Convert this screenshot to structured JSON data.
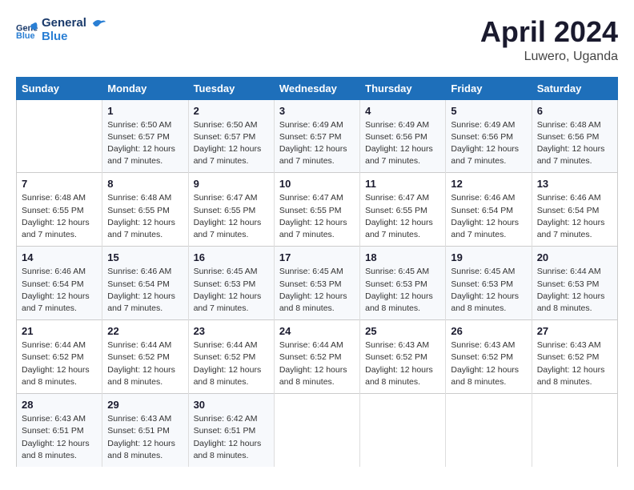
{
  "header": {
    "logo_general": "General",
    "logo_blue": "Blue",
    "month_year": "April 2024",
    "location": "Luwero, Uganda"
  },
  "columns": [
    "Sunday",
    "Monday",
    "Tuesday",
    "Wednesday",
    "Thursday",
    "Friday",
    "Saturday"
  ],
  "weeks": [
    [
      {
        "day": "",
        "info": ""
      },
      {
        "day": "1",
        "info": "Sunrise: 6:50 AM\nSunset: 6:57 PM\nDaylight: 12 hours\nand 7 minutes."
      },
      {
        "day": "2",
        "info": "Sunrise: 6:50 AM\nSunset: 6:57 PM\nDaylight: 12 hours\nand 7 minutes."
      },
      {
        "day": "3",
        "info": "Sunrise: 6:49 AM\nSunset: 6:57 PM\nDaylight: 12 hours\nand 7 minutes."
      },
      {
        "day": "4",
        "info": "Sunrise: 6:49 AM\nSunset: 6:56 PM\nDaylight: 12 hours\nand 7 minutes."
      },
      {
        "day": "5",
        "info": "Sunrise: 6:49 AM\nSunset: 6:56 PM\nDaylight: 12 hours\nand 7 minutes."
      },
      {
        "day": "6",
        "info": "Sunrise: 6:48 AM\nSunset: 6:56 PM\nDaylight: 12 hours\nand 7 minutes."
      }
    ],
    [
      {
        "day": "7",
        "info": "Sunrise: 6:48 AM\nSunset: 6:55 PM\nDaylight: 12 hours\nand 7 minutes."
      },
      {
        "day": "8",
        "info": "Sunrise: 6:48 AM\nSunset: 6:55 PM\nDaylight: 12 hours\nand 7 minutes."
      },
      {
        "day": "9",
        "info": "Sunrise: 6:47 AM\nSunset: 6:55 PM\nDaylight: 12 hours\nand 7 minutes."
      },
      {
        "day": "10",
        "info": "Sunrise: 6:47 AM\nSunset: 6:55 PM\nDaylight: 12 hours\nand 7 minutes."
      },
      {
        "day": "11",
        "info": "Sunrise: 6:47 AM\nSunset: 6:55 PM\nDaylight: 12 hours\nand 7 minutes."
      },
      {
        "day": "12",
        "info": "Sunrise: 6:46 AM\nSunset: 6:54 PM\nDaylight: 12 hours\nand 7 minutes."
      },
      {
        "day": "13",
        "info": "Sunrise: 6:46 AM\nSunset: 6:54 PM\nDaylight: 12 hours\nand 7 minutes."
      }
    ],
    [
      {
        "day": "14",
        "info": "Sunrise: 6:46 AM\nSunset: 6:54 PM\nDaylight: 12 hours\nand 7 minutes."
      },
      {
        "day": "15",
        "info": "Sunrise: 6:46 AM\nSunset: 6:54 PM\nDaylight: 12 hours\nand 7 minutes."
      },
      {
        "day": "16",
        "info": "Sunrise: 6:45 AM\nSunset: 6:53 PM\nDaylight: 12 hours\nand 7 minutes."
      },
      {
        "day": "17",
        "info": "Sunrise: 6:45 AM\nSunset: 6:53 PM\nDaylight: 12 hours\nand 8 minutes."
      },
      {
        "day": "18",
        "info": "Sunrise: 6:45 AM\nSunset: 6:53 PM\nDaylight: 12 hours\nand 8 minutes."
      },
      {
        "day": "19",
        "info": "Sunrise: 6:45 AM\nSunset: 6:53 PM\nDaylight: 12 hours\nand 8 minutes."
      },
      {
        "day": "20",
        "info": "Sunrise: 6:44 AM\nSunset: 6:53 PM\nDaylight: 12 hours\nand 8 minutes."
      }
    ],
    [
      {
        "day": "21",
        "info": "Sunrise: 6:44 AM\nSunset: 6:52 PM\nDaylight: 12 hours\nand 8 minutes."
      },
      {
        "day": "22",
        "info": "Sunrise: 6:44 AM\nSunset: 6:52 PM\nDaylight: 12 hours\nand 8 minutes."
      },
      {
        "day": "23",
        "info": "Sunrise: 6:44 AM\nSunset: 6:52 PM\nDaylight: 12 hours\nand 8 minutes."
      },
      {
        "day": "24",
        "info": "Sunrise: 6:44 AM\nSunset: 6:52 PM\nDaylight: 12 hours\nand 8 minutes."
      },
      {
        "day": "25",
        "info": "Sunrise: 6:43 AM\nSunset: 6:52 PM\nDaylight: 12 hours\nand 8 minutes."
      },
      {
        "day": "26",
        "info": "Sunrise: 6:43 AM\nSunset: 6:52 PM\nDaylight: 12 hours\nand 8 minutes."
      },
      {
        "day": "27",
        "info": "Sunrise: 6:43 AM\nSunset: 6:52 PM\nDaylight: 12 hours\nand 8 minutes."
      }
    ],
    [
      {
        "day": "28",
        "info": "Sunrise: 6:43 AM\nSunset: 6:51 PM\nDaylight: 12 hours\nand 8 minutes."
      },
      {
        "day": "29",
        "info": "Sunrise: 6:43 AM\nSunset: 6:51 PM\nDaylight: 12 hours\nand 8 minutes."
      },
      {
        "day": "30",
        "info": "Sunrise: 6:42 AM\nSunset: 6:51 PM\nDaylight: 12 hours\nand 8 minutes."
      },
      {
        "day": "",
        "info": ""
      },
      {
        "day": "",
        "info": ""
      },
      {
        "day": "",
        "info": ""
      },
      {
        "day": "",
        "info": ""
      }
    ]
  ]
}
